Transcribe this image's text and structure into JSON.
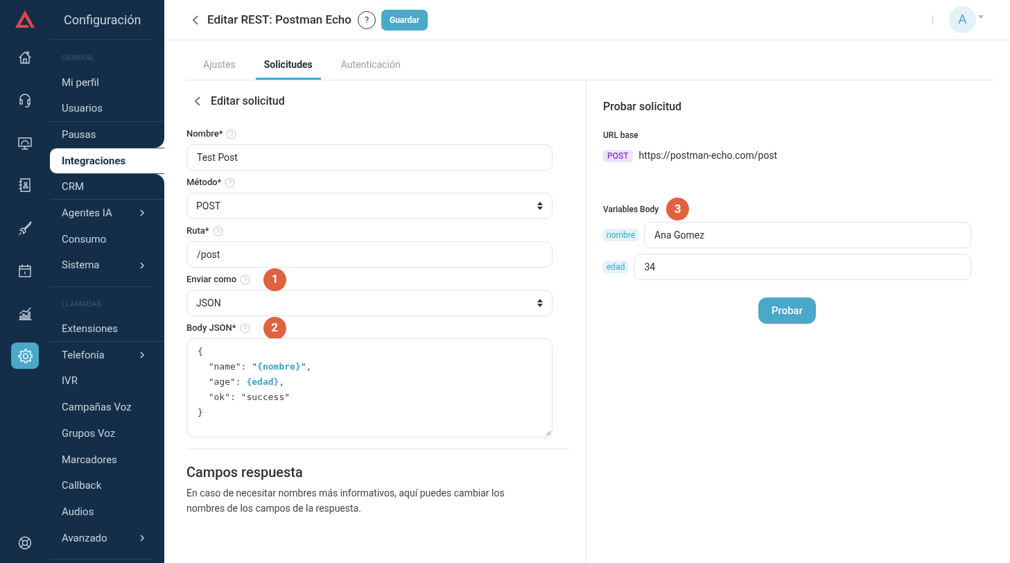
{
  "rail": {
    "items": [
      {
        "kind": "home",
        "selected": false
      },
      {
        "kind": "headset",
        "selected": false
      },
      {
        "kind": "monitor",
        "selected": false
      },
      {
        "kind": "contacts",
        "selected": false
      },
      {
        "kind": "rocket",
        "selected": false
      },
      {
        "kind": "calendar",
        "selected": false
      },
      {
        "kind": "chart",
        "selected": false
      },
      {
        "kind": "gear",
        "selected": true
      }
    ],
    "bottom": {
      "kind": "lifebuoy"
    }
  },
  "sidebar": {
    "title": "Configuración",
    "sections": [
      {
        "heading": "GENERAL",
        "items": [
          {
            "label": "Mi perfil",
            "selected": false,
            "submenu": false
          },
          {
            "label": "Usuarios",
            "selected": false,
            "submenu": false
          },
          {
            "label": "Pausas",
            "selected": false,
            "submenu": false
          },
          {
            "label": "Integraciones",
            "selected": true,
            "submenu": false
          },
          {
            "label": "CRM",
            "selected": false,
            "submenu": false
          },
          {
            "label": "Agentes IA",
            "selected": false,
            "submenu": true
          },
          {
            "label": "Consumo",
            "selected": false,
            "submenu": false
          },
          {
            "label": "Sistema",
            "selected": false,
            "submenu": true
          }
        ]
      },
      {
        "heading": "LLAMADAS",
        "items": [
          {
            "label": "Extensiones",
            "selected": false,
            "submenu": false
          },
          {
            "label": "Telefonía",
            "selected": false,
            "submenu": true
          },
          {
            "label": "IVR",
            "selected": false,
            "submenu": false
          },
          {
            "label": "Campañas Voz",
            "selected": false,
            "submenu": false
          },
          {
            "label": "Grupos Voz",
            "selected": false,
            "submenu": false
          },
          {
            "label": "Marcadores",
            "selected": false,
            "submenu": false
          },
          {
            "label": "Callback",
            "selected": false,
            "submenu": false
          },
          {
            "label": "Audios",
            "selected": false,
            "submenu": false
          },
          {
            "label": "Avanzado",
            "selected": false,
            "submenu": true
          }
        ]
      }
    ]
  },
  "header": {
    "title": "Editar REST: Postman Echo",
    "help": "?",
    "save_button": "Guardar",
    "avatar": "A"
  },
  "tabs": [
    {
      "label": "Ajustes",
      "selected": false
    },
    {
      "label": "Solicitudes",
      "selected": true
    },
    {
      "label": "Autenticación",
      "selected": false
    }
  ],
  "form": {
    "title": "Editar solicitud",
    "fields": [
      {
        "kind": "input",
        "label": "Nombre*",
        "value": "Test Post"
      },
      {
        "kind": "select",
        "label": "Método*",
        "value": "POST"
      },
      {
        "kind": "input",
        "label": "Ruta*",
        "value": "/post"
      },
      {
        "kind": "select",
        "label": "Enviar como",
        "value": "JSON",
        "marker": "1"
      },
      {
        "kind": "code",
        "label": "Body JSON*",
        "marker": "2",
        "lines": [
          [
            {
              "t": "{"
            }
          ],
          [
            {
              "t": "  \"name\": \""
            },
            {
              "t": "{nombre}",
              "var": true
            },
            {
              "t": "\","
            }
          ],
          [
            {
              "t": "  \"age\": "
            },
            {
              "t": "{edad}",
              "var": true
            },
            {
              "t": ","
            }
          ],
          [
            {
              "t": "  \"ok\": \"success\""
            }
          ],
          [
            {
              "t": "}"
            }
          ]
        ]
      }
    ],
    "response": {
      "title": "Campos respuesta",
      "description": "En caso de necesitar nombres más informativos, aquí puedes cambiar los nombres de los campos de la respuesta."
    }
  },
  "test": {
    "title": "Probar solicitud",
    "url_label": "URL base",
    "method": "POST",
    "url": "https://postman-echo.com/post",
    "variables_label": "Variables Body",
    "marker": "3",
    "variables": [
      {
        "name": "nombre",
        "value": "Ana Gomez"
      },
      {
        "name": "edad",
        "value": "34"
      }
    ],
    "button": "Probar"
  }
}
